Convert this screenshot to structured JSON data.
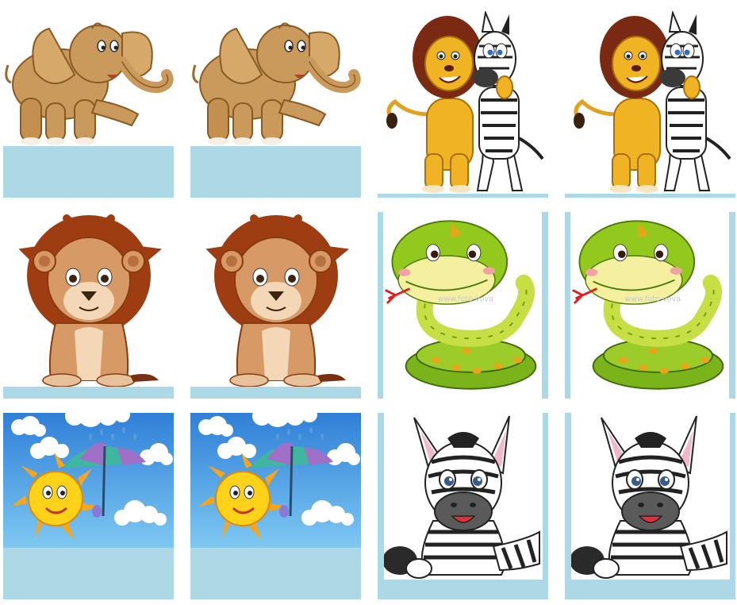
{
  "board": {
    "cards": [
      {
        "id": 1,
        "picture": "elephant-icon",
        "pair": "elephant"
      },
      {
        "id": 2,
        "picture": "elephant-icon",
        "pair": "elephant"
      },
      {
        "id": 3,
        "picture": "lion-and-zebra-icon",
        "pair": "lion-and-zebra"
      },
      {
        "id": 4,
        "picture": "lion-and-zebra-icon",
        "pair": "lion-and-zebra"
      },
      {
        "id": 5,
        "picture": "lion-icon",
        "pair": "lion"
      },
      {
        "id": 6,
        "picture": "lion-icon",
        "pair": "lion"
      },
      {
        "id": 7,
        "picture": "snake-icon",
        "pair": "snake"
      },
      {
        "id": 8,
        "picture": "snake-icon",
        "pair": "snake"
      },
      {
        "id": 9,
        "picture": "sun-with-umbrella-icon",
        "pair": "sun-with-umbrella"
      },
      {
        "id": 10,
        "picture": "sun-with-umbrella-icon",
        "pair": "sun-with-umbrella"
      },
      {
        "id": 11,
        "picture": "baby-zebra-icon",
        "pair": "baby-zebra"
      },
      {
        "id": 12,
        "picture": "baby-zebra-icon",
        "pair": "baby-zebra"
      }
    ],
    "colors": {
      "card_back": "#add8e6",
      "page_background": "#ffffff"
    }
  }
}
